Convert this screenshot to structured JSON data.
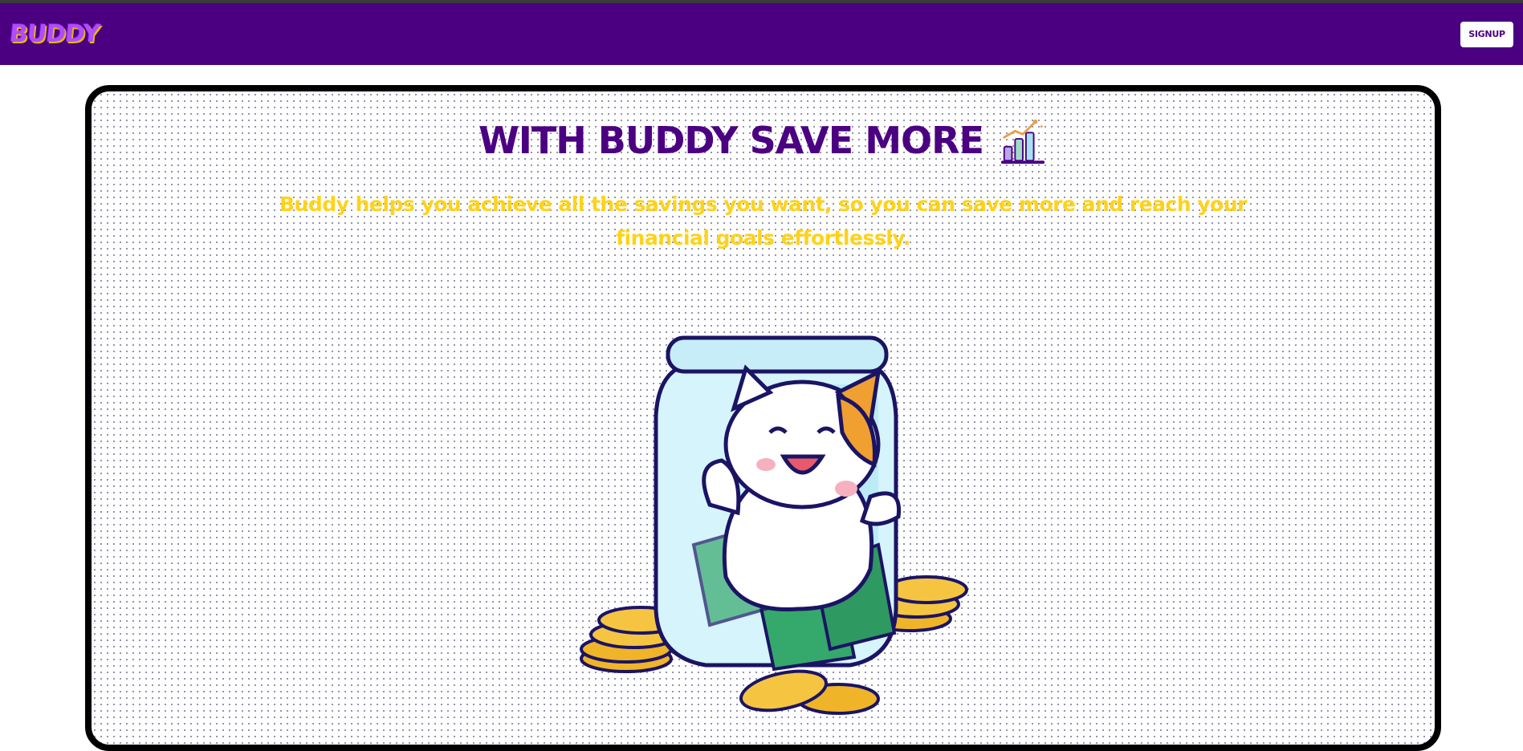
{
  "navbar": {
    "logo": "BUDDY",
    "signup_label": "SIGNUP"
  },
  "hero": {
    "headline": "WITH BUDDY SAVE MORE",
    "description": "Buddy helps you achieve all the savings you want, so you can save more and reach your financial goals effortlessly.",
    "chart_icon": "growth-chart-icon",
    "illustration": "cat-in-money-jar-illustration"
  },
  "colors": {
    "navbar_bg": "#4b0082",
    "headline": "#4b0082",
    "description": "#ffd21a",
    "logo": "#b24bff"
  }
}
